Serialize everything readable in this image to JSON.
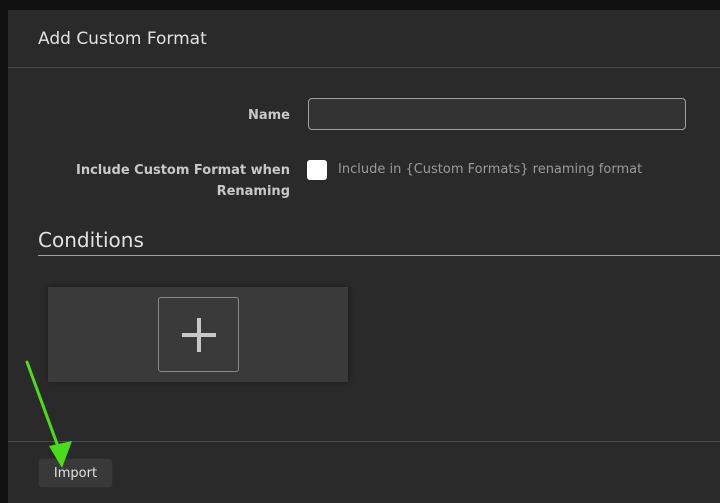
{
  "modal": {
    "title": "Add Custom Format"
  },
  "form": {
    "name_label": "Name",
    "name_value": "",
    "include_label": "Include Custom Format when Renaming",
    "include_checked": false,
    "include_help": "Include in {Custom Formats} renaming format"
  },
  "conditions": {
    "title": "Conditions",
    "add_icon": "plus-icon"
  },
  "footer": {
    "import_label": "Import"
  },
  "annotation": {
    "arrow_color": "#4cdb1a"
  }
}
